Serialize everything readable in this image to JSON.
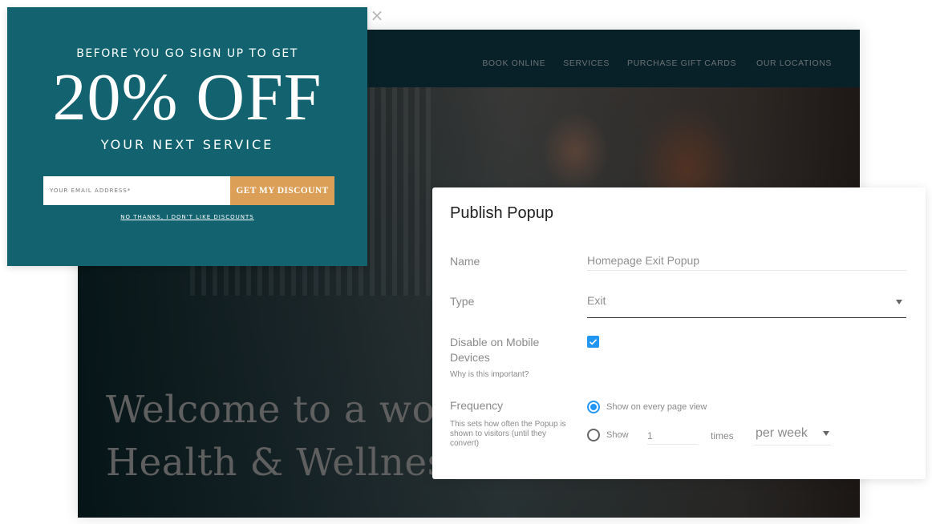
{
  "website": {
    "nav": [
      "BOOK ONLINE",
      "SERVICES",
      "PURCHASE GIFT CARDS",
      "OUR LOCATIONS"
    ],
    "hero_title_line1": "Welcome to a world of",
    "hero_title_line2": "Health & Wellness"
  },
  "email_popup": {
    "close_icon": "×",
    "pre_title": "BEFORE YOU GO SIGN UP TO GET",
    "offer": "20% OFF",
    "sub_title": "YOUR NEXT SERVICE",
    "email_placeholder": "YOUR EMAIL ADDRESS*",
    "email_value": "",
    "button_label": "GET MY DISCOUNT",
    "decline_link": "NO THANKS, I DON'T LIKE DISCOUNTS",
    "colors": {
      "background": "#12636f",
      "button": "#dc9f57"
    }
  },
  "publish_dialog": {
    "title": "Publish Popup",
    "name": {
      "label": "Name",
      "value": "Homepage Exit Popup"
    },
    "type": {
      "label": "Type",
      "value": "Exit"
    },
    "disable_mobile": {
      "label_line1": "Disable on Mobile",
      "label_line2": "Devices",
      "help": "Why is this important?",
      "checked": true
    },
    "frequency": {
      "label": "Frequency",
      "help": "This sets how often the Popup is shown to visitors (until they convert)",
      "option_every": "Show on every page view",
      "option_every_selected": true,
      "option_custom_prefix": "Show",
      "times_value": "1",
      "times_label": "times",
      "period_value": "per week"
    },
    "accent_color": "#2196f3"
  }
}
